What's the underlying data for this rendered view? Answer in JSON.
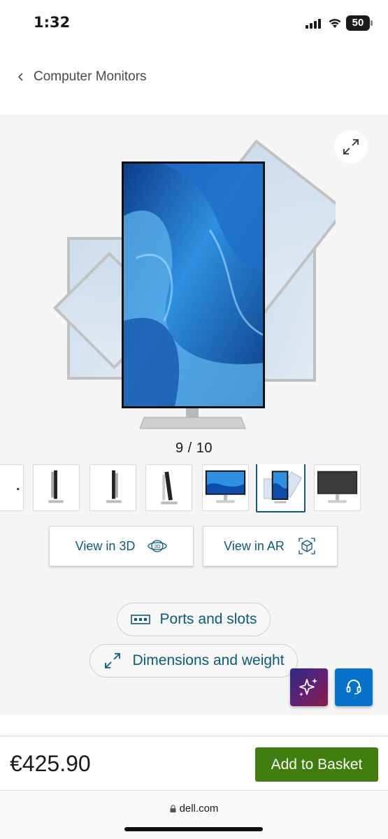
{
  "status_bar": {
    "time": "1:32",
    "battery_level": "50",
    "icons": [
      "signal-icon",
      "wifi-icon",
      "battery-icon"
    ]
  },
  "breadcrumb": {
    "label": "Computer Monitors",
    "icon": "chevron-left-icon"
  },
  "gallery": {
    "counter": "9 / 10",
    "current_index": 9,
    "total": 10,
    "expand_icon": "expand-icon",
    "thumbnails": [
      {
        "name": "thumb-side-partial"
      },
      {
        "name": "thumb-side-1"
      },
      {
        "name": "thumb-side-2"
      },
      {
        "name": "thumb-side-3"
      },
      {
        "name": "thumb-front"
      },
      {
        "name": "thumb-rotate",
        "active": true
      },
      {
        "name": "thumb-back"
      }
    ]
  },
  "view_buttons": {
    "view_3d": "View in 3D",
    "view_ar": "View in AR"
  },
  "pills": {
    "ports": "Ports and slots",
    "dimensions": "Dimensions and weight"
  },
  "fabs": {
    "ai_icon": "sparkle-icon",
    "support_icon": "headset-icon"
  },
  "purchase": {
    "price": "€425.90",
    "add_to_basket": "Add to Basket"
  },
  "browser": {
    "url": "dell.com"
  },
  "colors": {
    "link_blue": "#0b5a7f",
    "basket_green": "#3f7d0e",
    "support_blue": "#0672cb"
  }
}
